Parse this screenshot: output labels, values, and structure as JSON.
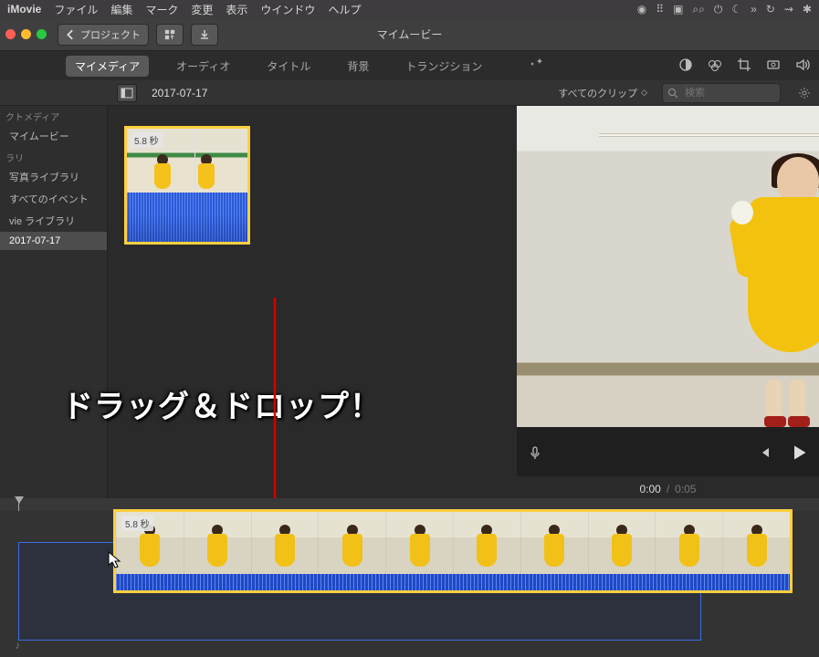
{
  "menubar": {
    "app": "iMovie",
    "items": [
      "ファイル",
      "編集",
      "マーク",
      "変更",
      "表示",
      "ウインドウ",
      "ヘルプ"
    ]
  },
  "toolbar": {
    "back_label": "プロジェクト",
    "title": "マイムービー"
  },
  "tabs": {
    "mymedia": "マイメディア",
    "audio": "オーディオ",
    "titles": "タイトル",
    "backgrounds": "背景",
    "transitions": "トランジション"
  },
  "browser_header": {
    "date": "2017-07-17",
    "clip_filter": "すべてのクリップ",
    "search_placeholder": "検索"
  },
  "sidebar": {
    "sec1": "クトメディア",
    "item_myMovie": "マイムービー",
    "sec2": "ラリ",
    "item_photoLib": "写真ライブラリ",
    "item_allEvents": "すべてのイベント",
    "item_ivieLib": "vie ライブラリ",
    "item_date": "2017-07-17"
  },
  "clip": {
    "duration_label": "5.8 秒"
  },
  "preview": {
    "time_current": "0:00",
    "time_sep": "/",
    "time_total": "0:05"
  },
  "timeline": {
    "clip_duration": "5.8 秒"
  },
  "annotation": {
    "text": "ドラッグ＆ドロップ！"
  },
  "colors": {
    "selection": "#ffcf3f",
    "timeline_audio": "#2b59d6"
  }
}
